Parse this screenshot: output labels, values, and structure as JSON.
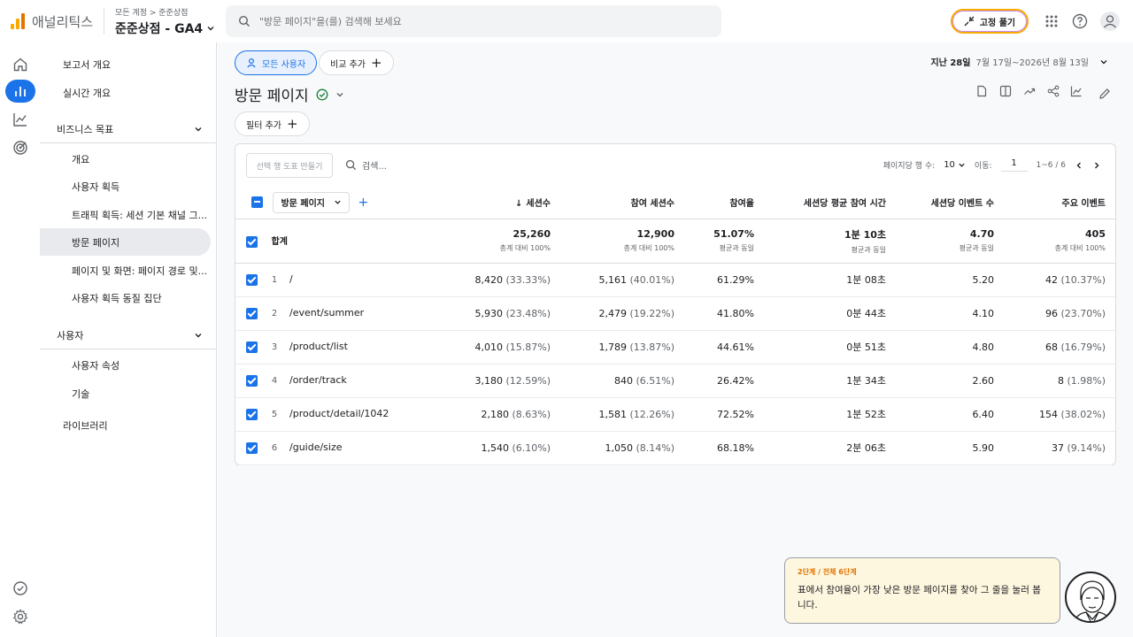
{
  "app": {
    "logo_text": "애널리틱스",
    "crumb": "모든 계정 > 준준상점",
    "property": "준준상점 - GA4"
  },
  "search": {
    "placeholder": "\"방문 페이지\"을(를) 검색해 보세요"
  },
  "header": {
    "pin_label": "고정 풀기"
  },
  "sidenav": {
    "overview": "보고서 개요",
    "realtime": "실시간 개요",
    "section_business": "비즈니스 목표",
    "items_business": [
      "개요",
      "사용자 획득",
      "트래픽 획득: 세션 기본 채널 그...",
      "방문 페이지",
      "페이지 및 화면: 페이지 경로 및...",
      "사용자 획득 동질 집단"
    ],
    "section_user": "사용자",
    "items_user": [
      "사용자 속성",
      "기술"
    ],
    "library": "라이브러리"
  },
  "toolbar": {
    "all_users": "모든 사용자",
    "add_compare": "비교 추가",
    "date_label": "지난 28일",
    "date_range": "7월 17일~2026년 8월 13일",
    "title": "방문 페이지",
    "add_filter": "필터 추가"
  },
  "table": {
    "make_button": "선택 행 도표 만들기",
    "search_placeholder": "검색...",
    "rows_per_page_label": "페이지당 행 수:",
    "rows_per_page": "10",
    "goto_label": "이동:",
    "goto_page": "1",
    "range": "1~6 / 6",
    "dimension": "방문 페이지",
    "headers": [
      "세션수",
      "참여 세션수",
      "참여율",
      "세션당 평균 참여 시간",
      "세션당 이벤트 수",
      "주요 이벤트"
    ],
    "total": {
      "label": "합계",
      "values": [
        "25,260",
        "12,900",
        "51.07%",
        "1분 10초",
        "4.70",
        "405"
      ],
      "subs": [
        "총계 대비 100%",
        "총계 대비 100%",
        "평균과 동일",
        "평균과 동일",
        "평균과 동일",
        "총계 대비 100%"
      ]
    },
    "rows": [
      {
        "num": "1",
        "page": "/",
        "sessions": "8,420",
        "sessions_pct": "(33.33%)",
        "engaged": "5,161",
        "engaged_pct": "(40.01%)",
        "rate": "61.29%",
        "time": "1분 08초",
        "events": "5.20",
        "key": "42",
        "key_pct": "(10.37%)"
      },
      {
        "num": "2",
        "page": "/event/summer",
        "sessions": "5,930",
        "sessions_pct": "(23.48%)",
        "engaged": "2,479",
        "engaged_pct": "(19.22%)",
        "rate": "41.80%",
        "time": "0분 44초",
        "events": "4.10",
        "key": "96",
        "key_pct": "(23.70%)"
      },
      {
        "num": "3",
        "page": "/product/list",
        "sessions": "4,010",
        "sessions_pct": "(15.87%)",
        "engaged": "1,789",
        "engaged_pct": "(13.87%)",
        "rate": "44.61%",
        "time": "0분 51초",
        "events": "4.80",
        "key": "68",
        "key_pct": "(16.79%)"
      },
      {
        "num": "4",
        "page": "/order/track",
        "sessions": "3,180",
        "sessions_pct": "(12.59%)",
        "engaged": "840",
        "engaged_pct": "(6.51%)",
        "rate": "26.42%",
        "time": "1분 34초",
        "events": "2.60",
        "key": "8",
        "key_pct": "(1.98%)"
      },
      {
        "num": "5",
        "page": "/product/detail/1042",
        "sessions": "2,180",
        "sessions_pct": "(8.63%)",
        "engaged": "1,581",
        "engaged_pct": "(12.26%)",
        "rate": "72.52%",
        "time": "1분 52초",
        "events": "6.40",
        "key": "154",
        "key_pct": "(38.02%)"
      },
      {
        "num": "6",
        "page": "/guide/size",
        "sessions": "1,540",
        "sessions_pct": "(6.10%)",
        "engaged": "1,050",
        "engaged_pct": "(8.14%)",
        "rate": "68.18%",
        "time": "2분 06초",
        "events": "5.90",
        "key": "37",
        "key_pct": "(9.14%)"
      }
    ]
  },
  "tour": {
    "step": "2단계 / 전체 6단계",
    "text": "표에서 참여율이 가장 낮은 방문 페이지를 찾아 그 줄을 눌러 봅니다."
  },
  "icons": [
    "search-icon",
    "pin-icon",
    "apps-icon",
    "help-icon",
    "account-icon",
    "home-icon",
    "reports-icon",
    "explore-icon",
    "advertising-icon",
    "checklist-icon",
    "settings-icon"
  ],
  "colors": {
    "accent": "#1a73e8",
    "logo_orange": "#f9ab00",
    "logo_dark": "#e37400",
    "success": "#188038"
  }
}
